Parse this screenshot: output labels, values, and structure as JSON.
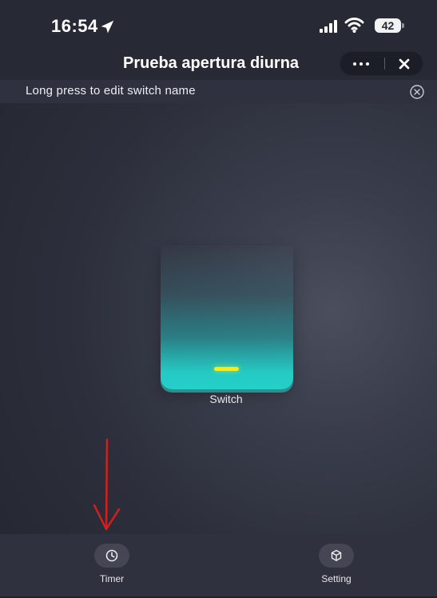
{
  "status_bar": {
    "time": "16:54",
    "battery": "42",
    "icons": [
      "location-arrow-icon",
      "cellular-signal-icon",
      "wifi-icon"
    ]
  },
  "header": {
    "title": "Prueba apertura diurna",
    "more_icon": "more-icon",
    "close_icon": "close-icon"
  },
  "hint": {
    "text": "Long press to edit switch name",
    "dismiss_icon": "close-circle-icon"
  },
  "switch": {
    "label": "Switch",
    "indicator_color": "#f2ed22",
    "active_color": "#23d0c9"
  },
  "bottom_bar": {
    "items": [
      {
        "label": "Timer",
        "icon": "clock-icon"
      },
      {
        "label": "Setting",
        "icon": "cube-icon"
      }
    ]
  },
  "annotation": {
    "color": "#d81d1d",
    "icon": "down-arrow-annotation"
  }
}
